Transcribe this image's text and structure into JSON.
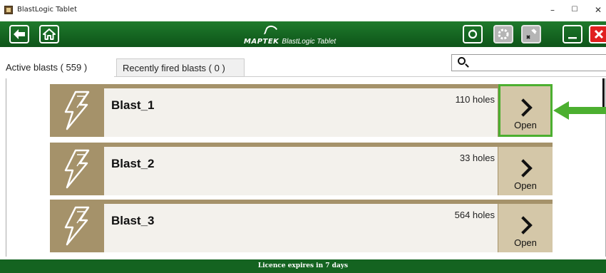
{
  "window": {
    "title": "BlastLogic Tablet",
    "minimize": "–",
    "maximize": "☐",
    "close": "✕"
  },
  "toolbar": {
    "back_icon": "arrow-left-icon",
    "home_icon": "home-icon",
    "brand_company": "MAPTEK",
    "brand_product": "BlastLogic Tablet",
    "sync_icon": "sync-icon",
    "settings_icon": "settings-icon",
    "tools_icon": "tools-icon",
    "minimize_icon": "minimize-icon",
    "close_icon": "close-icon"
  },
  "tabs": [
    {
      "label": "Active blasts ( 559 )",
      "active": true
    },
    {
      "label": "Recently fired blasts ( 0 )",
      "active": false
    }
  ],
  "search": {
    "placeholder": ""
  },
  "blasts": [
    {
      "name": "Blast_1",
      "holes": "110 holes",
      "open_label": "Open",
      "highlighted": true
    },
    {
      "name": "Blast_2",
      "holes": "33 holes",
      "open_label": "Open",
      "highlighted": false
    },
    {
      "name": "Blast_3",
      "holes": "564 holes",
      "open_label": "Open",
      "highlighted": false
    }
  ],
  "status": {
    "licence": "Licence expires in 7 days"
  },
  "colors": {
    "toolbar_green": "#146320",
    "row_tan": "#a5926a",
    "open_button": "#d4c7a8",
    "highlight_green": "#4caf30",
    "close_red": "#e02020"
  }
}
